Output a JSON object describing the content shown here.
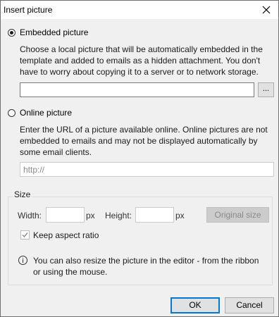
{
  "window": {
    "title": "Insert picture"
  },
  "embedded": {
    "label": "Embedded picture",
    "selected": true,
    "description_lines": [
      "Choose a local picture that will be automatically embedded in the",
      "template and added to emails as a hidden attachment. You don't",
      "have to worry about copying it to a server or to network storage."
    ],
    "path_value": "",
    "browse_label": "..."
  },
  "online": {
    "label": "Online picture",
    "selected": false,
    "description_lines": [
      "Enter the URL of a picture available online. Online pictures are not",
      "embedded to emails and may not be displayed automatically by",
      "some email clients."
    ],
    "url_placeholder": "http://"
  },
  "size": {
    "group_label": "Size",
    "width_label": "Width:",
    "width_value": "",
    "width_unit": "px",
    "height_label": "Height:",
    "height_value": "",
    "height_unit": "px",
    "original_size_label": "Original size",
    "keep_aspect_label": "Keep aspect ratio",
    "keep_aspect_checked": true,
    "info_lines": [
      "You can also resize the picture in the editor - from the ribbon",
      "or using the mouse."
    ]
  },
  "footer": {
    "ok_label": "OK",
    "cancel_label": "Cancel"
  }
}
